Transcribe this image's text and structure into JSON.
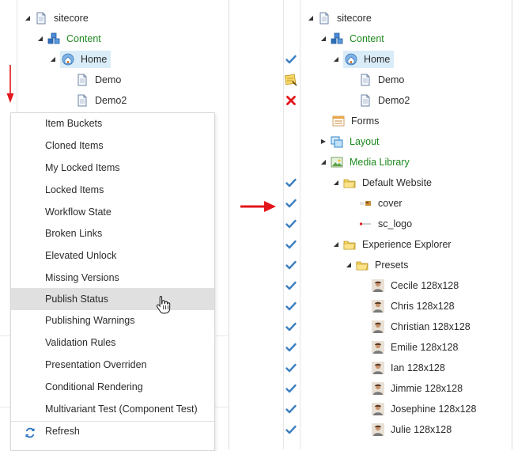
{
  "left_tree": {
    "sitecore": "sitecore",
    "content": "Content",
    "home": "Home",
    "demo": "Demo",
    "demo2": "Demo2"
  },
  "context_menu": {
    "items": [
      "Item Buckets",
      "Cloned Items",
      "My Locked Items",
      "Locked Items",
      "Workflow State",
      "Broken Links",
      "Elevated Unlock",
      "Missing Versions",
      "Publish Status",
      "Publishing Warnings",
      "Validation Rules",
      "Presentation Overriden",
      "Conditional Rendering",
      "Multivariant Test (Component Test)"
    ],
    "refresh": "Refresh",
    "hovered_item": "Publish Status"
  },
  "right_tree": {
    "sitecore": "sitecore",
    "content": "Content",
    "home": "Home",
    "demo": "Demo",
    "demo2": "Demo2",
    "forms": "Forms",
    "layout": "Layout",
    "media_library": "Media Library",
    "default_website": "Default Website",
    "cover": "cover",
    "sc_logo": "sc_logo",
    "experience_explorer": "Experience Explorer",
    "presets": "Presets",
    "cecile": "Cecile 128x128",
    "chris": "Chris 128x128",
    "christian": "Christian 128x128",
    "emilie": "Emilie 128x128",
    "ian": "Ian 128x128",
    "jimmie": "Jimmie 128x128",
    "josephine": "Josephine 128x128",
    "julie": "Julie 128x128"
  },
  "colors": {
    "accent_red": "#e3161b",
    "check_blue": "#3d7fc1",
    "green_text": "#1e8a1e",
    "selection": "#d9ecf8"
  }
}
